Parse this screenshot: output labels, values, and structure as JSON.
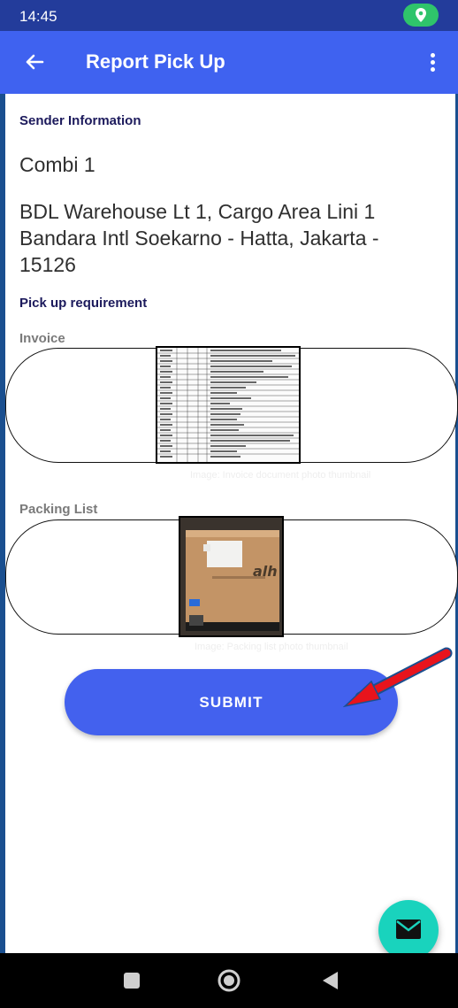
{
  "status_bar": {
    "time": "14:45",
    "location_icon": "location-pin-icon"
  },
  "app_bar": {
    "back_icon": "arrow-left-icon",
    "title": "Report Pick Up",
    "menu_icon": "more-vert-icon"
  },
  "sender": {
    "section_title": "Sender Information",
    "name": "Combi 1",
    "address": "BDL Warehouse Lt 1, Cargo Area Lini 1 Bandara Intl Soekarno - Hatta, Jakarta - 15126"
  },
  "requirements": {
    "section_title": "Pick up requirement",
    "invoice": {
      "label": "Invoice",
      "caption": "Image: Invoice document photo thumbnail"
    },
    "packing_list": {
      "label": "Packing List",
      "caption": "Image: Packing list photo thumbnail"
    }
  },
  "submit": {
    "label": "SUBMIT"
  },
  "fab": {
    "icon": "mail-icon"
  },
  "nav_bar": {
    "items": [
      "square-recents-icon",
      "circle-home-icon",
      "triangle-back-icon"
    ]
  },
  "colors": {
    "status_bar": "#233c9b",
    "app_bar": "#3f62f0",
    "submit": "#4361ee",
    "fab": "#19d3bd",
    "annotation_arrow": "#e8141c"
  }
}
